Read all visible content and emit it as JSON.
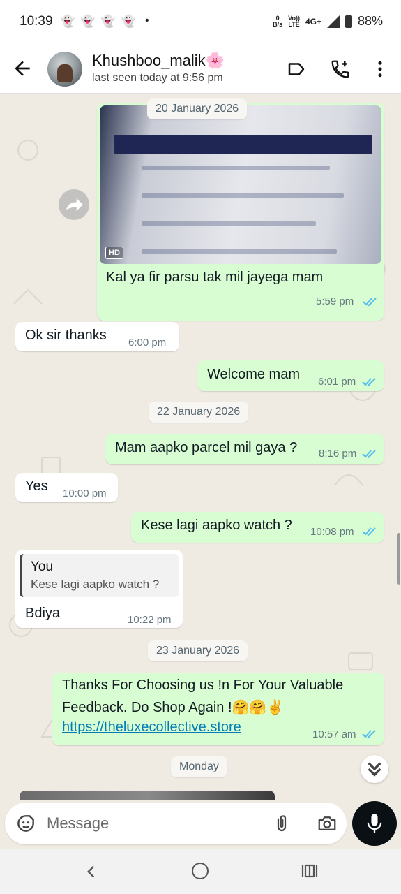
{
  "status_bar": {
    "time": "10:39",
    "notification_icons": [
      "snapchat-icon",
      "snapchat-icon",
      "snapchat-icon",
      "snapchat-icon"
    ],
    "dot": "•",
    "data_speed_top": "0",
    "data_speed_unit": "B/s",
    "volte_top": "Vo))",
    "volte_bottom": "LTE",
    "network": "4G+",
    "battery": "88%"
  },
  "header": {
    "contact_name": "Khushboo_malik🌸",
    "last_seen": "last seen today at 9:56 pm"
  },
  "messages": {
    "date1": "20 January 2026",
    "m1_text": "Kal ya fir parsu tak mil jayega mam",
    "m1_time": "5:59 pm",
    "m1_badge": "HD",
    "m2_text": "Ok sir thanks",
    "m2_time": "6:00 pm",
    "m3_text": "Welcome mam",
    "m3_time": "6:01 pm",
    "date2": "22 January 2026",
    "m4_text": "Mam aapko parcel mil gaya ?",
    "m4_time": "8:16 pm",
    "m5_text": "Yes",
    "m5_time": "10:00 pm",
    "m6_text": "Kese lagi aapko watch ?",
    "m6_time": "10:08 pm",
    "m7_quote_author": "You",
    "m7_quote_text": "Kese lagi aapko watch ?",
    "m7_text": "Bdiya",
    "m7_time": "10:22 pm",
    "date3": "23 January 2026",
    "m8_line1": "Thanks For Choosing us !n For Your Valuable",
    "m8_line2": "Feedback. Do Shop Again !🤗🤗✌️",
    "m8_link": "https://theluxecollective.store",
    "m8_time": "10:57 am",
    "date4": "Monday"
  },
  "composer": {
    "placeholder": "Message"
  },
  "colors": {
    "outgoing_bubble": "#d9fdd3",
    "incoming_bubble": "#ffffff",
    "read_ticks": "#53bdeb",
    "link": "#027eb5",
    "mic_button": "#0b1014"
  }
}
